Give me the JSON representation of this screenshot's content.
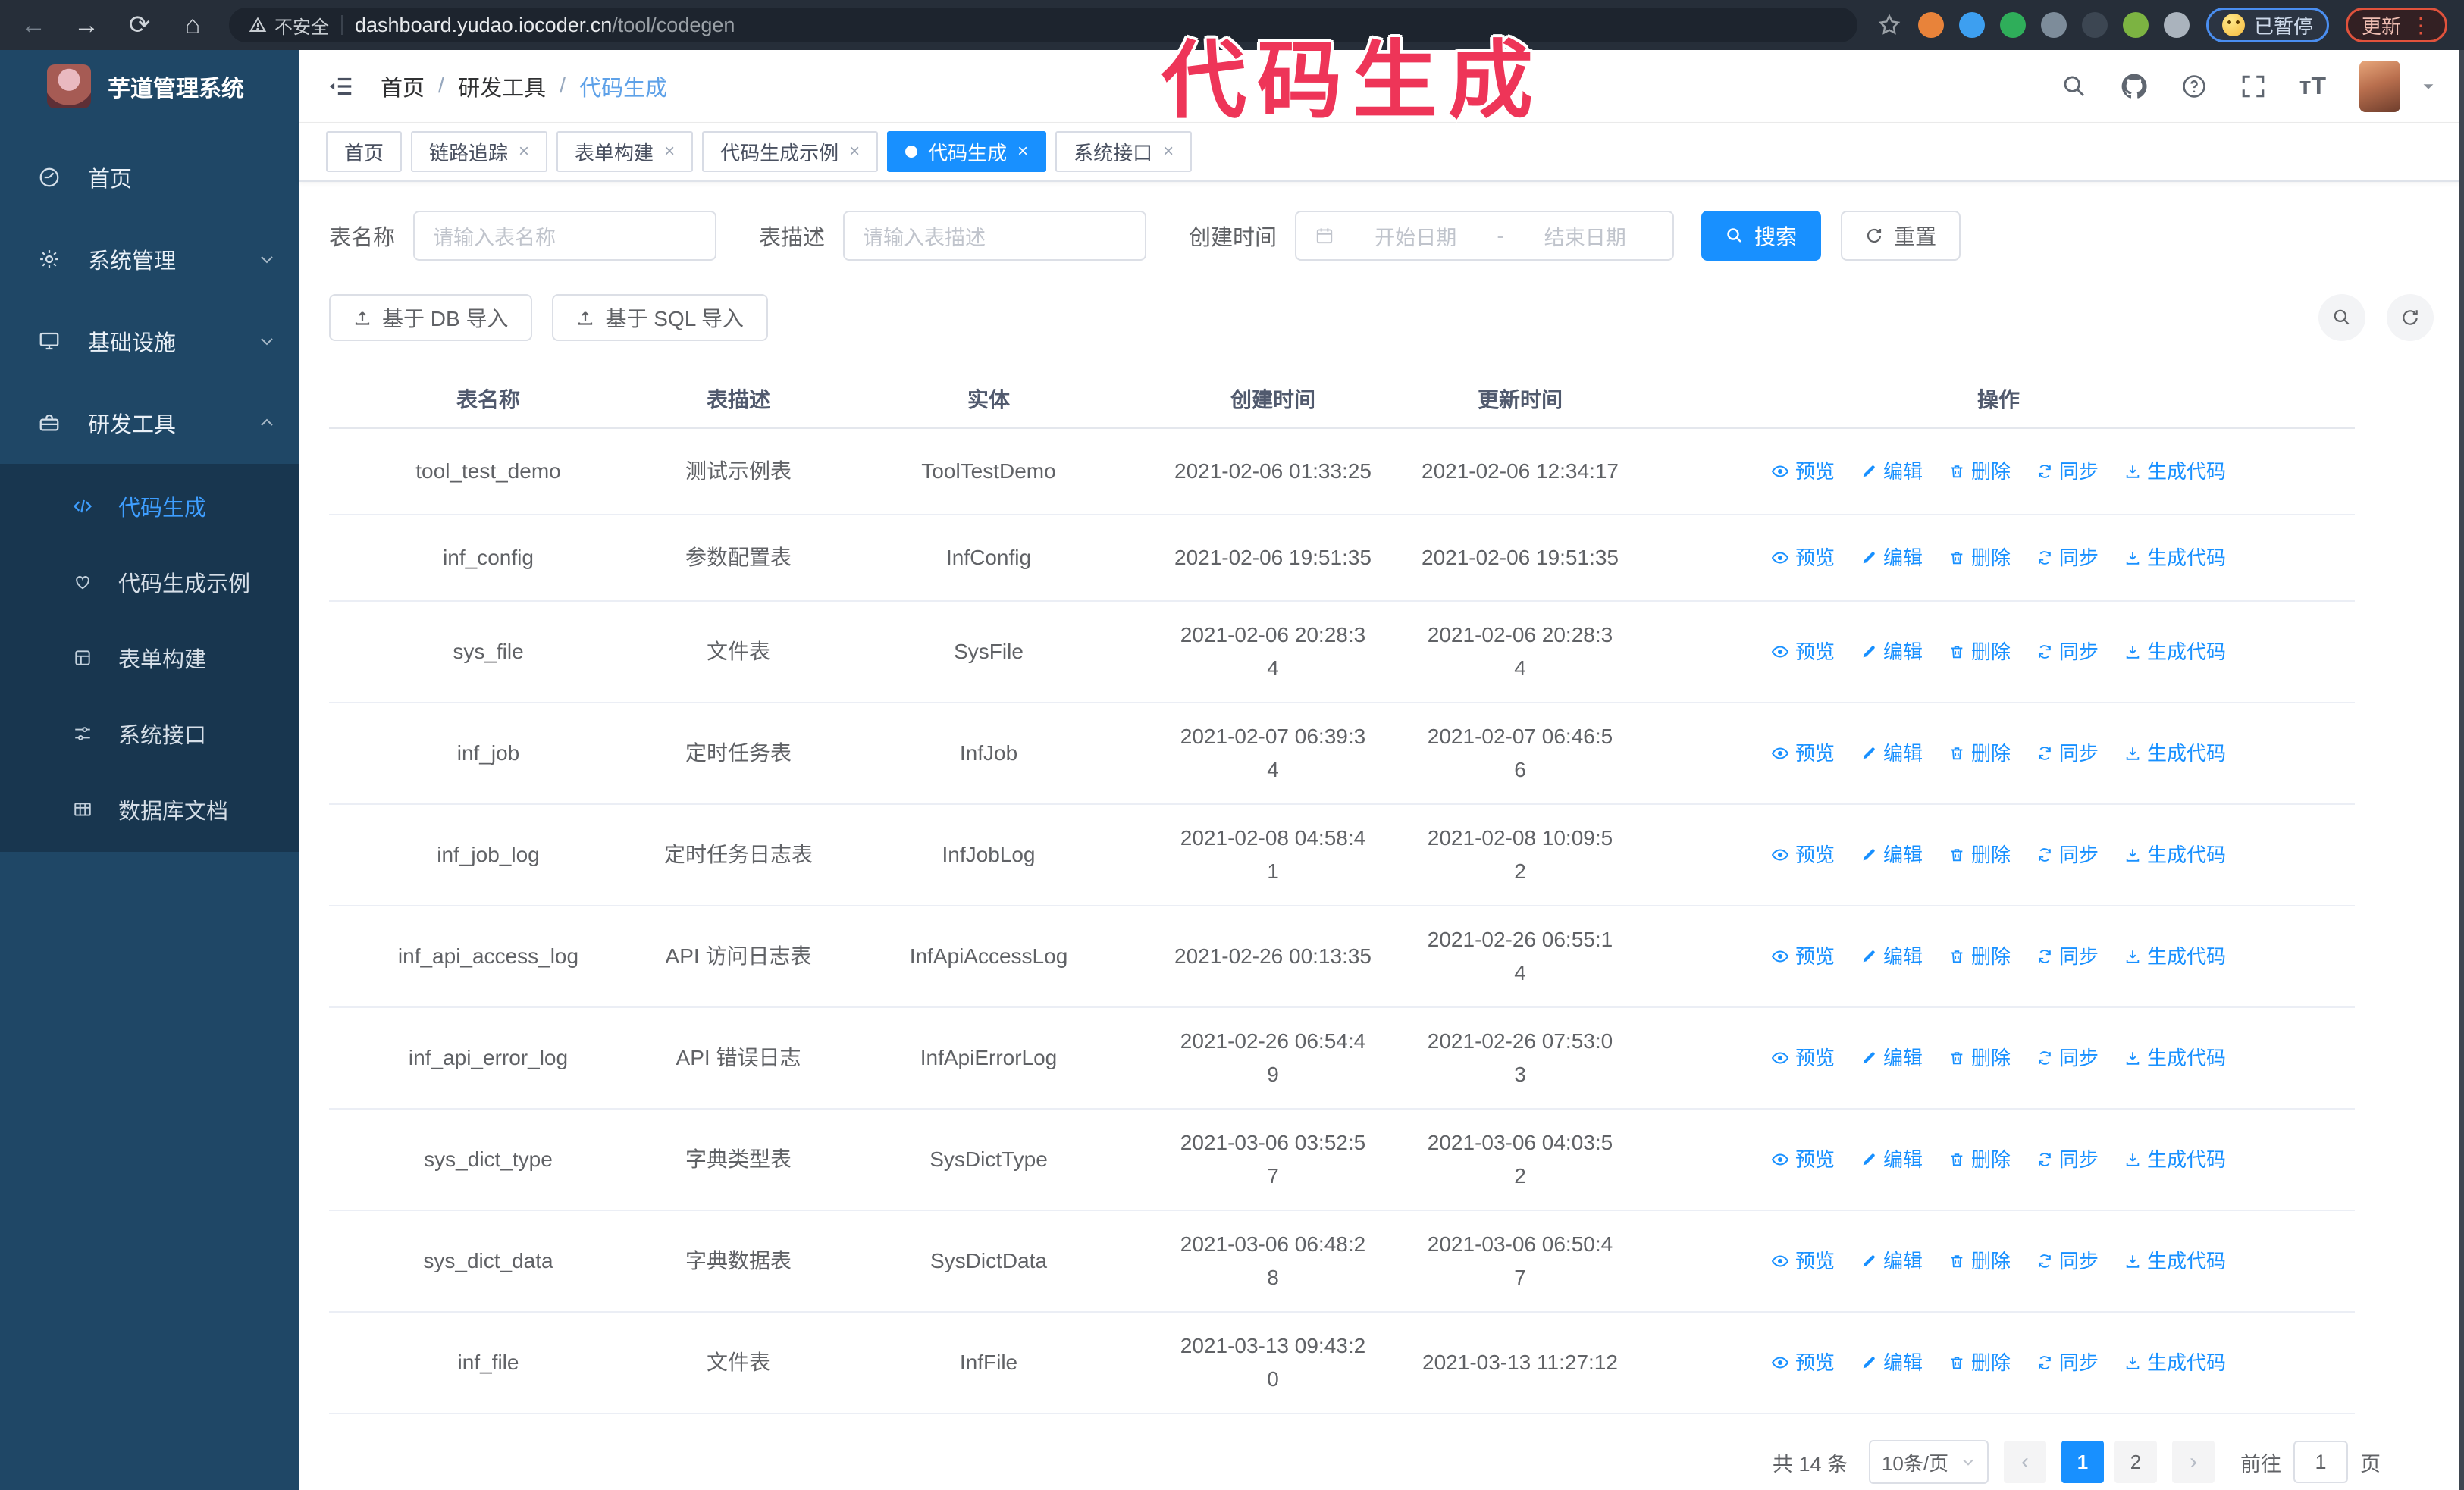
{
  "browser": {
    "nav": {
      "back": "back-icon",
      "forward": "forward-icon",
      "reload": "reload-icon",
      "home": "home-icon"
    },
    "security_label": "不安全",
    "url_domain": "dashboard.yudao.iocoder.cn",
    "url_path": "/tool/codegen",
    "extensions": [
      {
        "name": "extension-orange-icon",
        "color": "#e8833a"
      },
      {
        "name": "extension-blue-gem-icon",
        "color": "#3d9ff0"
      },
      {
        "name": "extension-green-check-icon",
        "color": "#2fae5a"
      },
      {
        "name": "extension-gray-grid-icon",
        "color": "#7d8c9a"
      },
      {
        "name": "extension-on-badge-icon",
        "color": "#3c4652"
      },
      {
        "name": "extension-green-person-icon",
        "color": "#7cb342"
      },
      {
        "name": "extension-puzzle-icon",
        "color": "#aab3bd"
      }
    ],
    "paused_badge_label": "已暂停",
    "update_button_label": "更新",
    "update_menu_dots": "⋮"
  },
  "annotation": {
    "text": "代码生成",
    "color": "#ee3558"
  },
  "sidebar": {
    "title": "芋道管理系统",
    "menu": [
      {
        "icon": "dashboard-icon",
        "label": "首页",
        "chevron": ""
      },
      {
        "icon": "gear-icon",
        "label": "系统管理",
        "chevron": "down"
      },
      {
        "icon": "monitor-icon",
        "label": "基础设施",
        "chevron": "down"
      },
      {
        "icon": "toolbox-icon",
        "label": "研发工具",
        "chevron": "up"
      }
    ],
    "submenu": [
      {
        "icon": "code-icon",
        "label": "代码生成",
        "active": true
      },
      {
        "icon": "heart-icon",
        "label": "代码生成示例",
        "active": false
      },
      {
        "icon": "form-icon",
        "label": "表单构建",
        "active": false
      },
      {
        "icon": "sliders-icon",
        "label": "系统接口",
        "active": false
      },
      {
        "icon": "table-grid-icon",
        "label": "数据库文档",
        "active": false
      }
    ]
  },
  "header": {
    "breadcrumb": [
      "首页",
      "研发工具",
      "代码生成"
    ],
    "icons": [
      "search-icon",
      "github-icon",
      "help-icon",
      "fullscreen-icon",
      "font-size-icon"
    ]
  },
  "tabs": [
    {
      "label": "首页",
      "closable": false,
      "active": false
    },
    {
      "label": "链路追踪",
      "closable": true,
      "active": false
    },
    {
      "label": "表单构建",
      "closable": true,
      "active": false
    },
    {
      "label": "代码生成示例",
      "closable": true,
      "active": false
    },
    {
      "label": "代码生成",
      "closable": true,
      "active": true
    },
    {
      "label": "系统接口",
      "closable": true,
      "active": false
    }
  ],
  "filters": {
    "table_name": {
      "label": "表名称",
      "placeholder": "请输入表名称"
    },
    "table_desc": {
      "label": "表描述",
      "placeholder": "请输入表描述"
    },
    "create_time": {
      "label": "创建时间",
      "start_placeholder": "开始日期",
      "separator": "-",
      "end_placeholder": "结束日期"
    },
    "search_label": "搜索",
    "reset_label": "重置"
  },
  "toolbar": {
    "import_db_label": "基于 DB 导入",
    "import_sql_label": "基于 SQL 导入"
  },
  "table": {
    "columns": [
      "表名称",
      "表描述",
      "实体",
      "创建时间",
      "更新时间",
      "操作"
    ],
    "actions": [
      {
        "icon": "eye-icon",
        "label": "预览"
      },
      {
        "icon": "edit-icon",
        "label": "编辑"
      },
      {
        "icon": "delete-icon",
        "label": "删除"
      },
      {
        "icon": "sync-icon",
        "label": "同步"
      },
      {
        "icon": "generate-icon",
        "label": "生成代码"
      }
    ],
    "rows": [
      {
        "name": "tool_test_demo",
        "desc": "测试示例表",
        "entity": "ToolTestDemo",
        "created": "2021-02-06 01:33:25",
        "updated": "2021-02-06 12:34:17",
        "created_wrap": false,
        "updated_wrap": false
      },
      {
        "name": "inf_config",
        "desc": "参数配置表",
        "entity": "InfConfig",
        "created": "2021-02-06 19:51:35",
        "updated": "2021-02-06 19:51:35",
        "created_wrap": false,
        "updated_wrap": false
      },
      {
        "name": "sys_file",
        "desc": "文件表",
        "entity": "SysFile",
        "created": "2021-02-06 20:28:34",
        "updated": "2021-02-06 20:28:34",
        "created_wrap": true,
        "updated_wrap": true
      },
      {
        "name": "inf_job",
        "desc": "定时任务表",
        "entity": "InfJob",
        "created": "2021-02-07 06:39:34",
        "updated": "2021-02-07 06:46:56",
        "created_wrap": true,
        "updated_wrap": true
      },
      {
        "name": "inf_job_log",
        "desc": "定时任务日志表",
        "entity": "InfJobLog",
        "created": "2021-02-08 04:58:41",
        "updated": "2021-02-08 10:09:52",
        "created_wrap": true,
        "updated_wrap": true
      },
      {
        "name": "inf_api_access_log",
        "desc": "API 访问日志表",
        "entity": "InfApiAccessLog",
        "created": "2021-02-26 00:13:35",
        "updated": "2021-02-26 06:55:14",
        "created_wrap": false,
        "updated_wrap": true
      },
      {
        "name": "inf_api_error_log",
        "desc": "API 错误日志",
        "entity": "InfApiErrorLog",
        "created": "2021-02-26 06:54:49",
        "updated": "2021-02-26 07:53:03",
        "created_wrap": true,
        "updated_wrap": true
      },
      {
        "name": "sys_dict_type",
        "desc": "字典类型表",
        "entity": "SysDictType",
        "created": "2021-03-06 03:52:57",
        "updated": "2021-03-06 04:03:52",
        "created_wrap": true,
        "updated_wrap": true
      },
      {
        "name": "sys_dict_data",
        "desc": "字典数据表",
        "entity": "SysDictData",
        "created": "2021-03-06 06:48:28",
        "updated": "2021-03-06 06:50:47",
        "created_wrap": true,
        "updated_wrap": true
      },
      {
        "name": "inf_file",
        "desc": "文件表",
        "entity": "InfFile",
        "created": "2021-03-13 09:43:20",
        "updated": "2021-03-13 11:27:12",
        "created_wrap": true,
        "updated_wrap": false
      }
    ]
  },
  "pagination": {
    "total_text": "共 14 条",
    "page_size_text": "10条/页",
    "pages": [
      "1",
      "2"
    ],
    "active_page": "1",
    "goto_label": "前往",
    "goto_value": "1",
    "goto_unit": "页"
  },
  "colors": {
    "accent": "#1890ff",
    "sidebar_bg": "#1f4766",
    "submenu_bg": "#18364f",
    "annotation": "#ee3558"
  }
}
